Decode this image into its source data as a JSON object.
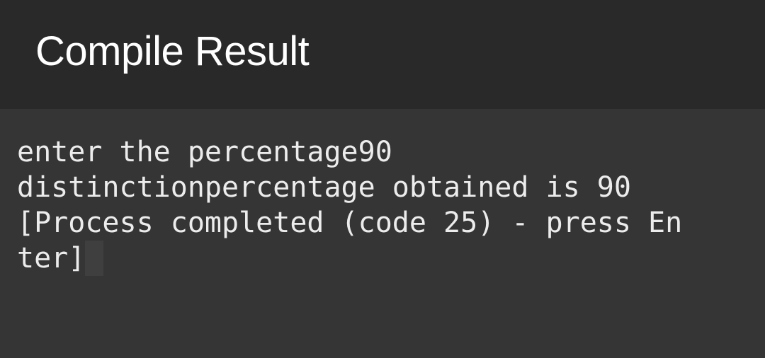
{
  "header": {
    "title": "Compile Result"
  },
  "console": {
    "lines": [
      "enter the percentage90",
      "distinctionpercentage obtained is 90",
      "[Process completed (code 25) - press En",
      "ter]"
    ]
  },
  "colors": {
    "header_bg": "#292929",
    "console_bg": "#353535",
    "text": "#ececec"
  }
}
